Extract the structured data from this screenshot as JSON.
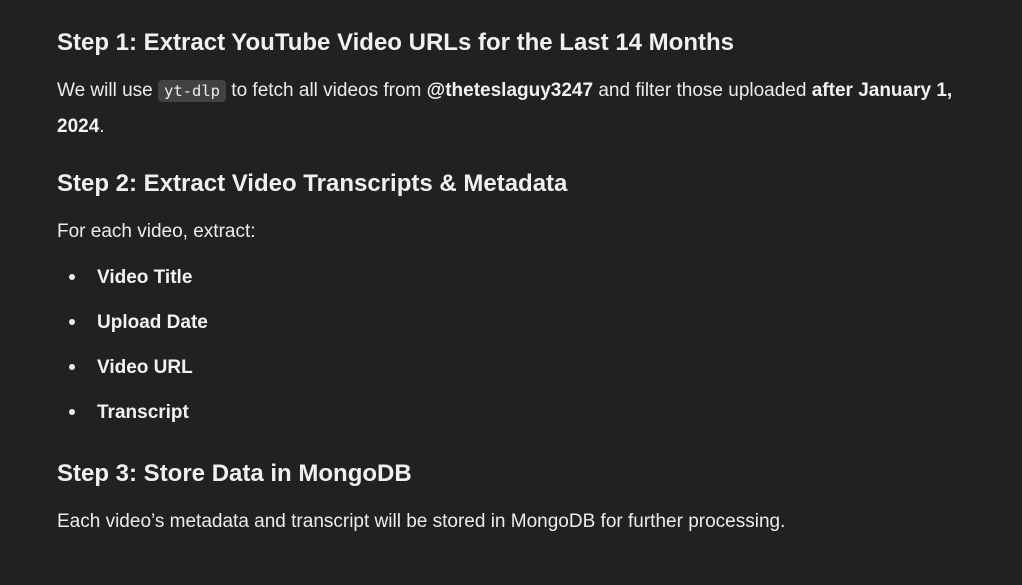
{
  "steps": [
    {
      "heading": "Step 1: Extract YouTube Video URLs for the Last 14 Months",
      "text_before": "We will use ",
      "code": "yt-dlp",
      "text_mid": " to fetch all videos from ",
      "channel": "@theteslaguy3247",
      "text_mid2": " and filter those uploaded ",
      "date_emphasis": "after January 1, 2024",
      "text_end": "."
    },
    {
      "heading": "Step 2: Extract Video Transcripts & Metadata",
      "intro": "For each video, extract:",
      "items": [
        "Video Title",
        "Upload Date",
        "Video URL",
        "Transcript"
      ]
    },
    {
      "heading": "Step 3: Store Data in MongoDB",
      "text": "Each video’s metadata and transcript will be stored in MongoDB for further processing."
    }
  ]
}
